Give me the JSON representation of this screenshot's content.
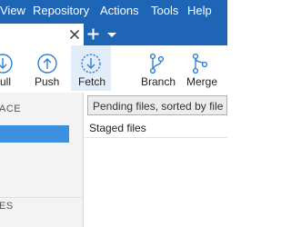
{
  "menubar": {
    "items": [
      "View",
      "Repository",
      "Actions",
      "Tools",
      "Help"
    ],
    "bg_color": "#1e65b5"
  },
  "tabs": {
    "close_icon": "close-icon",
    "add_icon": "plus-icon",
    "dropdown_icon": "chevron-down-icon"
  },
  "toolbar": {
    "pull_label": "ull",
    "push_label": "Push",
    "fetch_label": "Fetch",
    "branch_label": "Branch",
    "merge_label": "Merge",
    "icon_color": "#2f7fd3"
  },
  "sidebar": {
    "workspace_heading": "ACE",
    "second_heading": "ES"
  },
  "main": {
    "filter_text": "Pending files, sorted by file status",
    "staged_files_label": "Staged files"
  }
}
